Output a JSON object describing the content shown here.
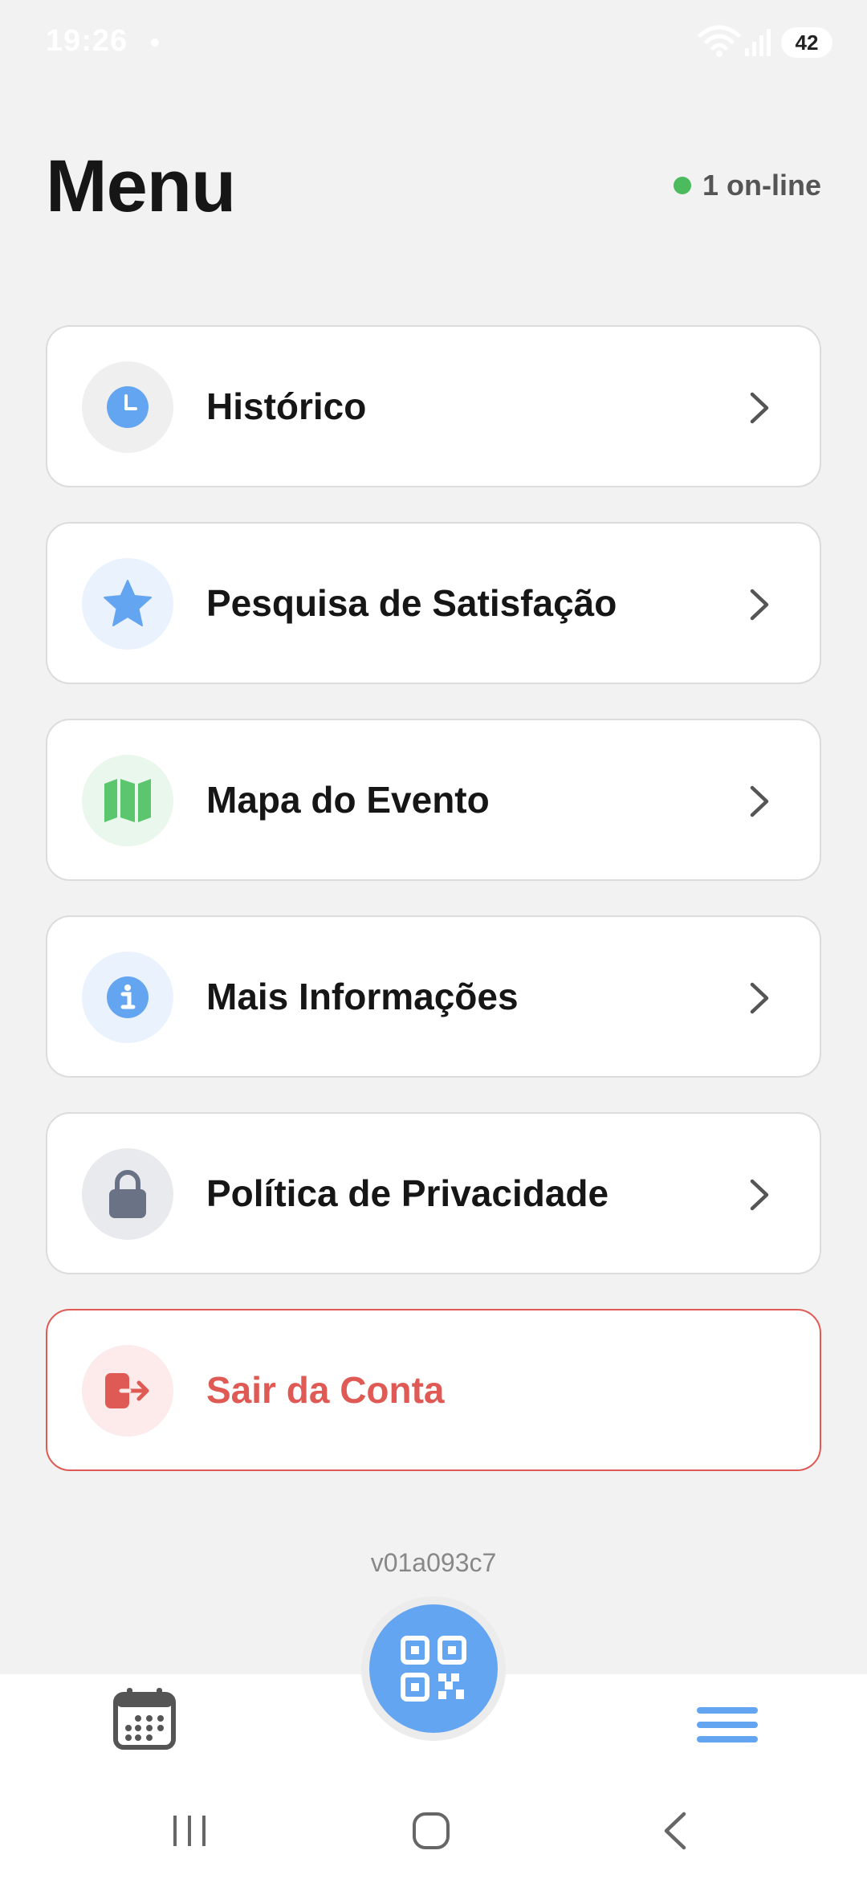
{
  "status_bar": {
    "time": "19:26",
    "battery": "42"
  },
  "header": {
    "title": "Menu",
    "online_status": "1 on-line"
  },
  "menu": {
    "items": [
      {
        "label": "Histórico",
        "icon": "clock-icon",
        "icon_color": "#64a5f2",
        "icon_bg": "#efefef"
      },
      {
        "label": "Pesquisa de Satisfação",
        "icon": "star-icon",
        "icon_color": "#64a5f2",
        "icon_bg": "#eaf3fd"
      },
      {
        "label": "Mapa do Evento",
        "icon": "map-icon",
        "icon_color": "#5cc66e",
        "icon_bg": "#e9f7ec"
      },
      {
        "label": "Mais Informações",
        "icon": "info-icon",
        "icon_color": "#64a5f2",
        "icon_bg": "#eaf3fd"
      },
      {
        "label": "Política de Privacidade",
        "icon": "lock-icon",
        "icon_color": "#6a7385",
        "icon_bg": "#e9eaee"
      }
    ],
    "logout": {
      "label": "Sair da Conta",
      "icon": "logout-icon",
      "icon_color": "#e05a55",
      "icon_bg": "#fcebea"
    }
  },
  "footer": {
    "version": "v01a093c7"
  },
  "colors": {
    "accent": "#64a5f2",
    "danger": "#e05a55",
    "online": "#4cbb5e"
  }
}
